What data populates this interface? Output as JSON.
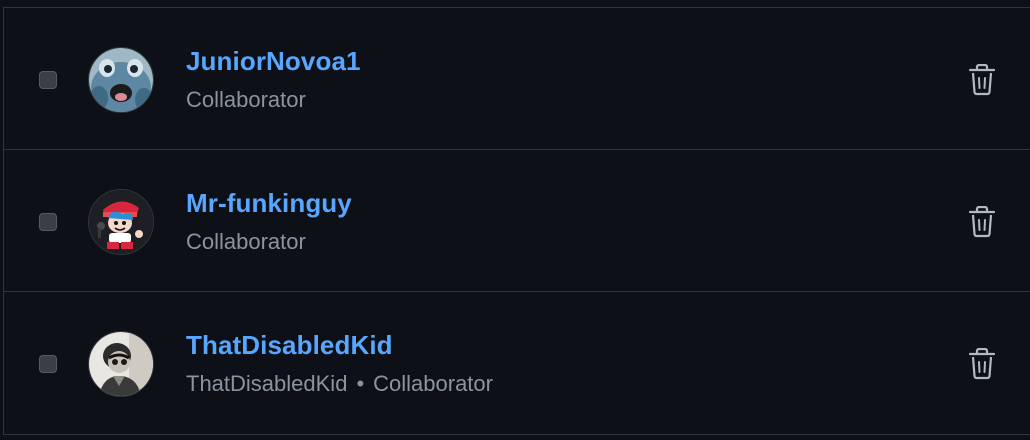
{
  "collaborators": [
    {
      "username": "JuniorNovoa1",
      "display_name": "",
      "role": "Collaborator",
      "avatar_icon": "blue-creature-avatar"
    },
    {
      "username": "Mr-funkinguy",
      "display_name": "",
      "role": "Collaborator",
      "avatar_icon": "cartoon-character-avatar"
    },
    {
      "username": "ThatDisabledKid",
      "display_name": "ThatDisabledKid",
      "separator": "•",
      "role": "Collaborator",
      "avatar_icon": "photo-portrait-avatar"
    }
  ],
  "colors": {
    "background": "#0d1117",
    "link": "#58a6ff",
    "muted": "#8b949e",
    "border": "#30363d"
  }
}
